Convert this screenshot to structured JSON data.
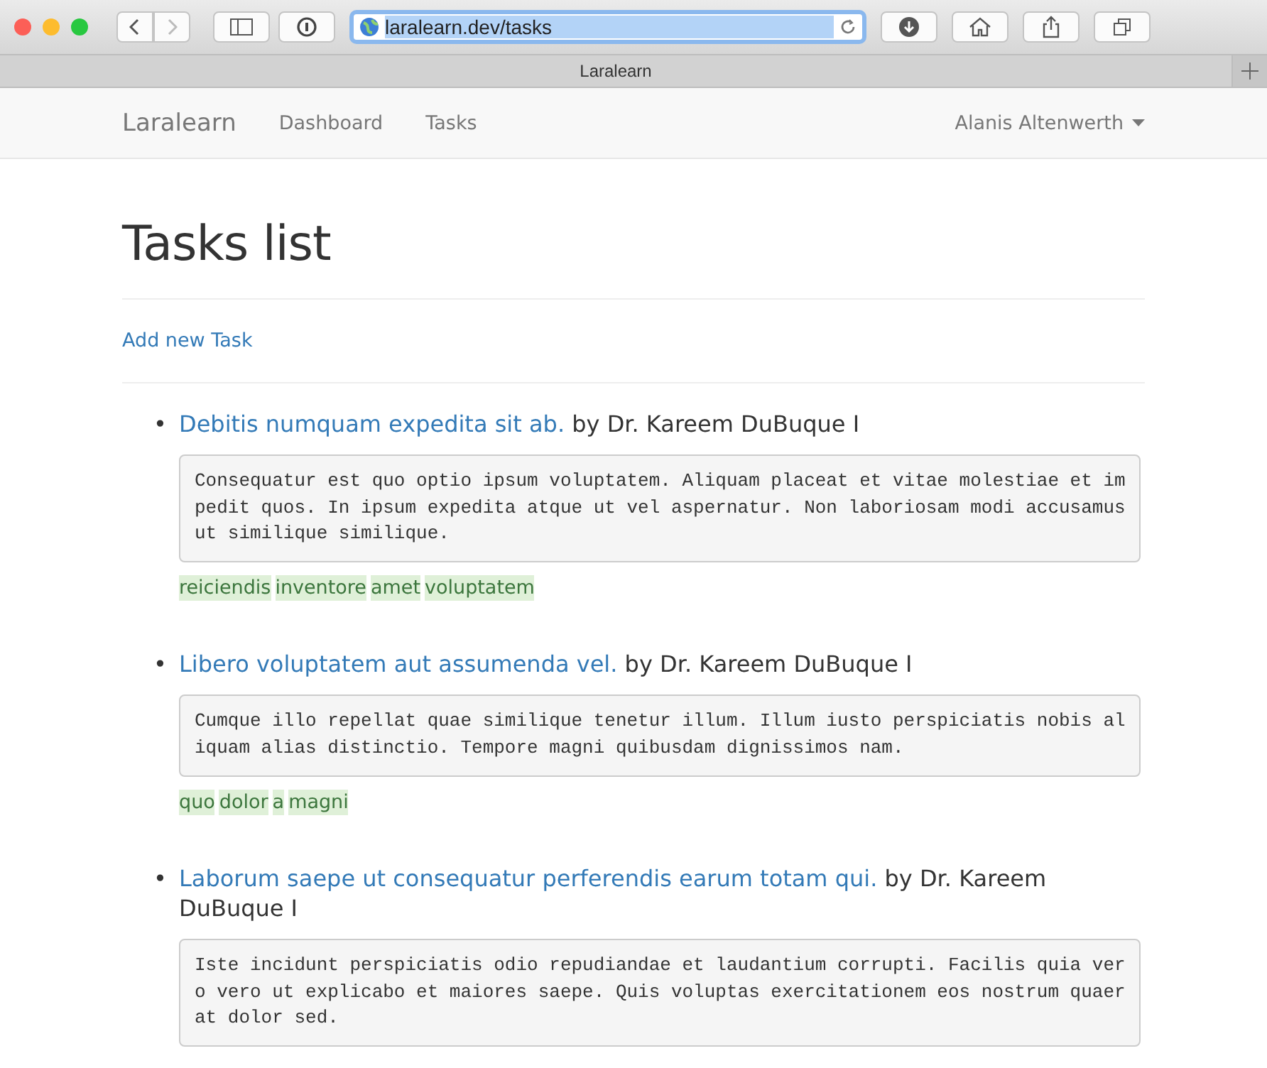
{
  "browser": {
    "url": "laralearn.dev/tasks",
    "tab_title": "Laralearn"
  },
  "navbar": {
    "brand": "Laralearn",
    "links": [
      "Dashboard",
      "Tasks"
    ],
    "user": "Alanis Altenwerth"
  },
  "page": {
    "title": "Tasks list",
    "add_link": "Add new Task"
  },
  "tasks": [
    {
      "marker": "•",
      "title": "Debitis numquam expedita sit ab.",
      "author": "by Dr. Kareem DuBuque I",
      "body": "Consequatur est quo optio ipsum voluptatem. Aliquam placeat et vitae molestiae et impedit quos. In ipsum expedita atque ut vel aspernatur. Non laboriosam modi accusamus ut similique similique.",
      "tags": [
        "reiciendis",
        "inventore",
        "amet",
        "voluptatem"
      ]
    },
    {
      "marker": "•",
      "title": "Libero voluptatem aut assumenda vel.",
      "author": "by Dr. Kareem DuBuque I",
      "body": "Cumque illo repellat quae similique tenetur illum. Illum iusto perspiciatis nobis aliquam alias distinctio. Tempore magni quibusdam dignissimos nam.",
      "tags": [
        "quo",
        "dolor",
        "a",
        "magni"
      ]
    },
    {
      "marker": "•",
      "title": "Laborum saepe ut consequatur perferendis earum totam qui.",
      "author": "by Dr. Kareem DuBuque I",
      "body": "Iste incidunt perspiciatis odio repudiandae et laudantium corrupti. Facilis quia vero vero ut explicabo et maiores saepe. Quis voluptas exercitationem eos nostrum quaerat dolor sed."
    }
  ]
}
